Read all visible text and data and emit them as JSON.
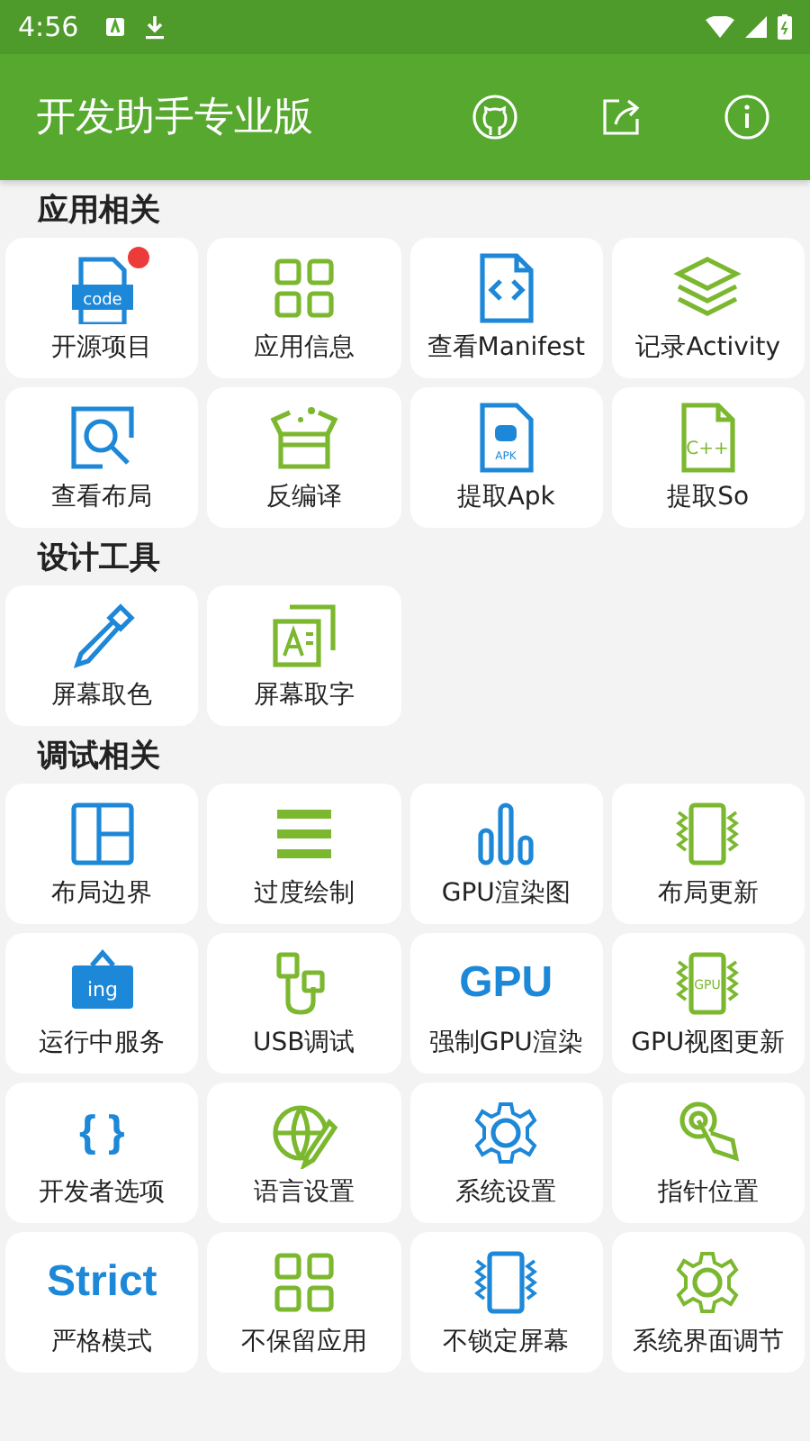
{
  "status_bar": {
    "time": "4:56"
  },
  "app_bar": {
    "title": "开发助手专业版"
  },
  "sections": [
    {
      "title": "应用相关",
      "items": [
        {
          "label": "开源项目",
          "kind": "code",
          "icon_text": "code",
          "color": "#1e88d8",
          "badge": true
        },
        {
          "label": "应用信息",
          "kind": "grid",
          "color": "#7cb82f",
          "badge": false
        },
        {
          "label": "查看Manifest",
          "kind": "manifest",
          "color": "#1e88d8",
          "badge": false
        },
        {
          "label": "记录Activity",
          "kind": "layers",
          "color": "#7cb82f",
          "badge": false
        },
        {
          "label": "查看布局",
          "kind": "inspect",
          "color": "#1e88d8",
          "badge": false
        },
        {
          "label": "反编译",
          "kind": "box",
          "color": "#7cb82f",
          "badge": false
        },
        {
          "label": "提取Apk",
          "kind": "apk",
          "icon_text": "APK",
          "color": "#1e88d8",
          "badge": false
        },
        {
          "label": "提取So",
          "kind": "file",
          "icon_text": "C++",
          "color": "#7cb82f",
          "badge": false
        }
      ]
    },
    {
      "title": "设计工具",
      "items": [
        {
          "label": "屏幕取色",
          "kind": "dropper",
          "color": "#1e88d8",
          "badge": false
        },
        {
          "label": "屏幕取字",
          "kind": "textgrab",
          "color": "#7cb82f",
          "badge": false
        }
      ]
    },
    {
      "title": "调试相关",
      "items": [
        {
          "label": "布局边界",
          "kind": "border",
          "color": "#1e88d8",
          "badge": false
        },
        {
          "label": "过度绘制",
          "kind": "lines",
          "color": "#7cb82f",
          "badge": false
        },
        {
          "label": "GPU渲染图",
          "kind": "bars",
          "color": "#1e88d8",
          "badge": false
        },
        {
          "label": "布局更新",
          "kind": "phone",
          "color": "#7cb82f",
          "badge": false
        },
        {
          "label": "运行中服务",
          "kind": "sign",
          "icon_text": "ing",
          "color": "#1e88d8",
          "badge": false
        },
        {
          "label": "USB调试",
          "kind": "usb",
          "color": "#7cb82f",
          "badge": false
        },
        {
          "label": "强制GPU渲染",
          "kind": "word",
          "icon_text": "GPU",
          "color": "#1e88d8",
          "badge": false
        },
        {
          "label": "GPU视图更新",
          "kind": "phone",
          "icon_text": "GPU",
          "color": "#7cb82f",
          "badge": false
        },
        {
          "label": "开发者选项",
          "kind": "word",
          "icon_text": "{ }",
          "color": "#1e88d8",
          "badge": false
        },
        {
          "label": "语言设置",
          "kind": "globe",
          "color": "#7cb82f",
          "badge": false
        },
        {
          "label": "系统设置",
          "kind": "gear",
          "color": "#1e88d8",
          "badge": false
        },
        {
          "label": "指针位置",
          "kind": "touch",
          "color": "#7cb82f",
          "badge": false
        },
        {
          "label": "严格模式",
          "kind": "word",
          "icon_text": "Strict",
          "color": "#1e88d8",
          "badge": false
        },
        {
          "label": "不保留应用",
          "kind": "grid",
          "color": "#7cb82f",
          "badge": false
        },
        {
          "label": "不锁定屏幕",
          "kind": "phone",
          "color": "#1e88d8",
          "badge": false
        },
        {
          "label": "系统界面调节",
          "kind": "gear",
          "color": "#7cb82f",
          "badge": false
        }
      ]
    }
  ]
}
